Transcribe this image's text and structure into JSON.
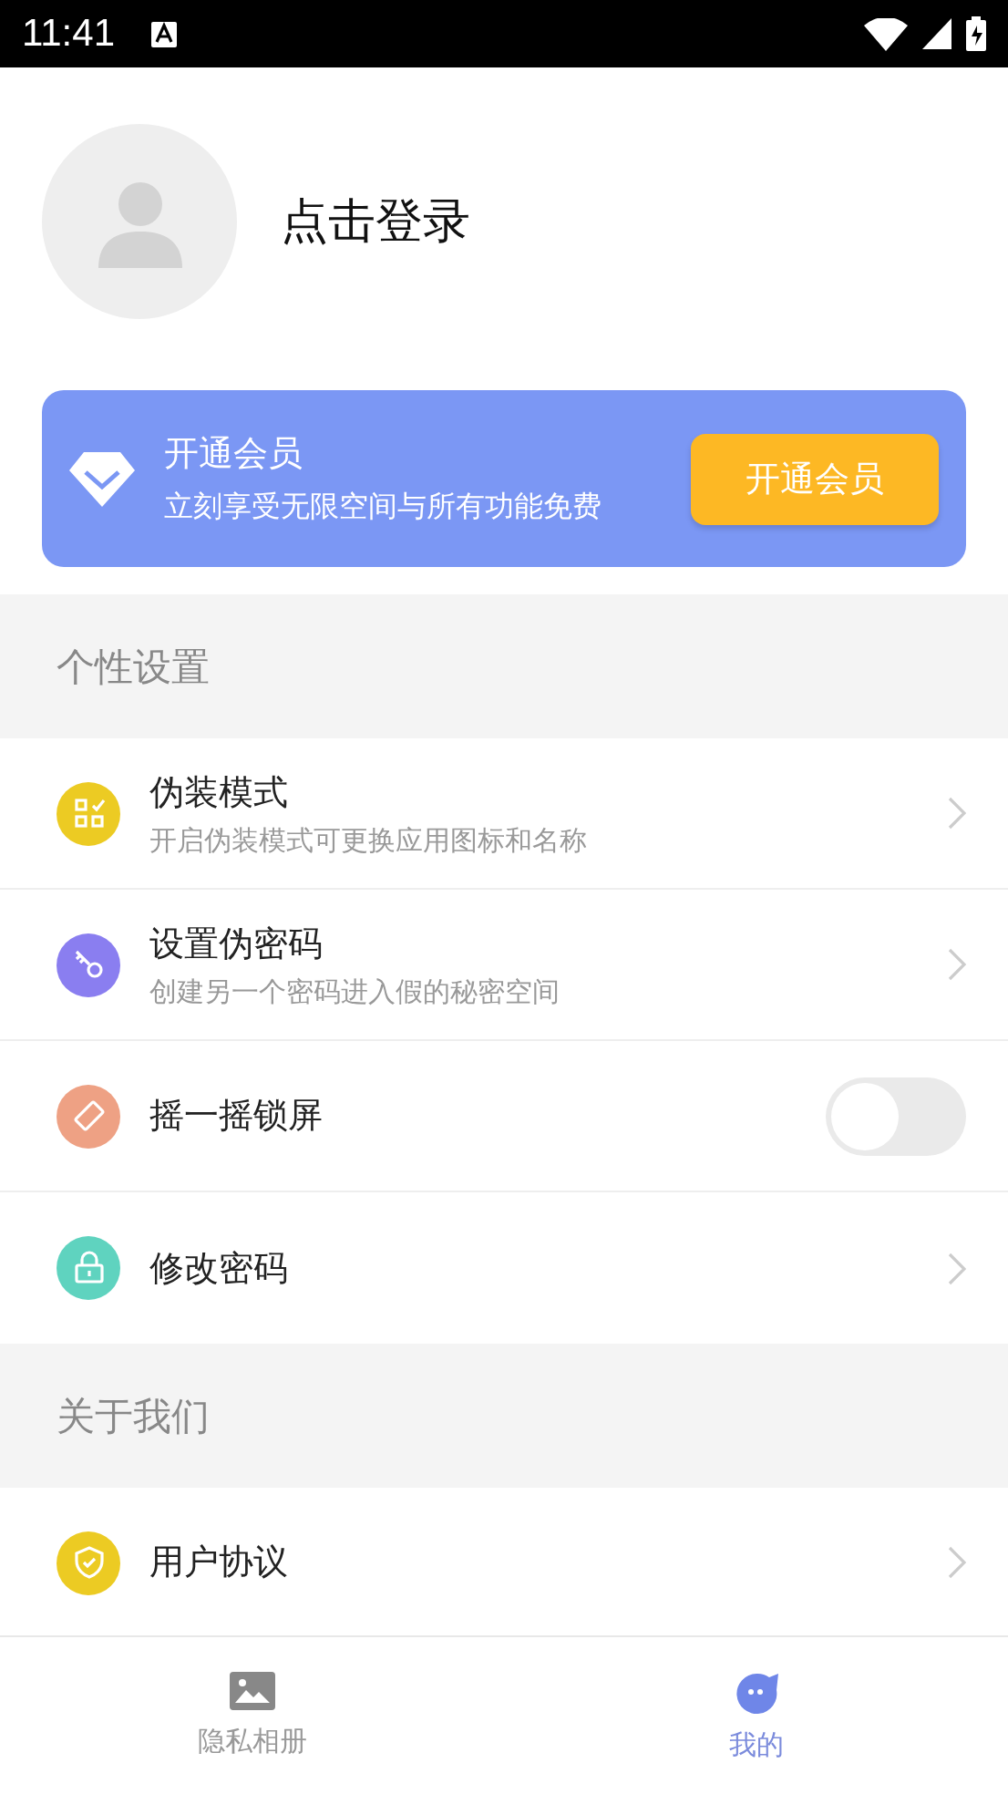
{
  "status_bar": {
    "time": "11:41"
  },
  "profile": {
    "login_text": "点击登录"
  },
  "vip_banner": {
    "title": "开通会员",
    "subtitle": "立刻享受无限空间与所有功能免费",
    "button": "开通会员"
  },
  "sections": [
    {
      "title": "个性设置",
      "items": [
        {
          "kind": "link",
          "color": "#eccb23",
          "title": "伪装模式",
          "subtitle": "开启伪装模式可更换应用图标和名称"
        },
        {
          "kind": "link",
          "color": "#8a7ef0",
          "title": "设置伪密码",
          "subtitle": "创建另一个密码进入假的秘密空间"
        },
        {
          "kind": "toggle",
          "color": "#eea184",
          "title": "摇一摇锁屏",
          "on": false
        },
        {
          "kind": "link",
          "color": "#5fd3bf",
          "title": "修改密码"
        }
      ]
    },
    {
      "title": "关于我们",
      "items": [
        {
          "kind": "link",
          "color": "#eccb23",
          "title": "用户协议"
        }
      ]
    }
  ],
  "tab_bar": [
    {
      "label": "隐私相册",
      "selected": false
    },
    {
      "label": "我的",
      "selected": true
    }
  ]
}
